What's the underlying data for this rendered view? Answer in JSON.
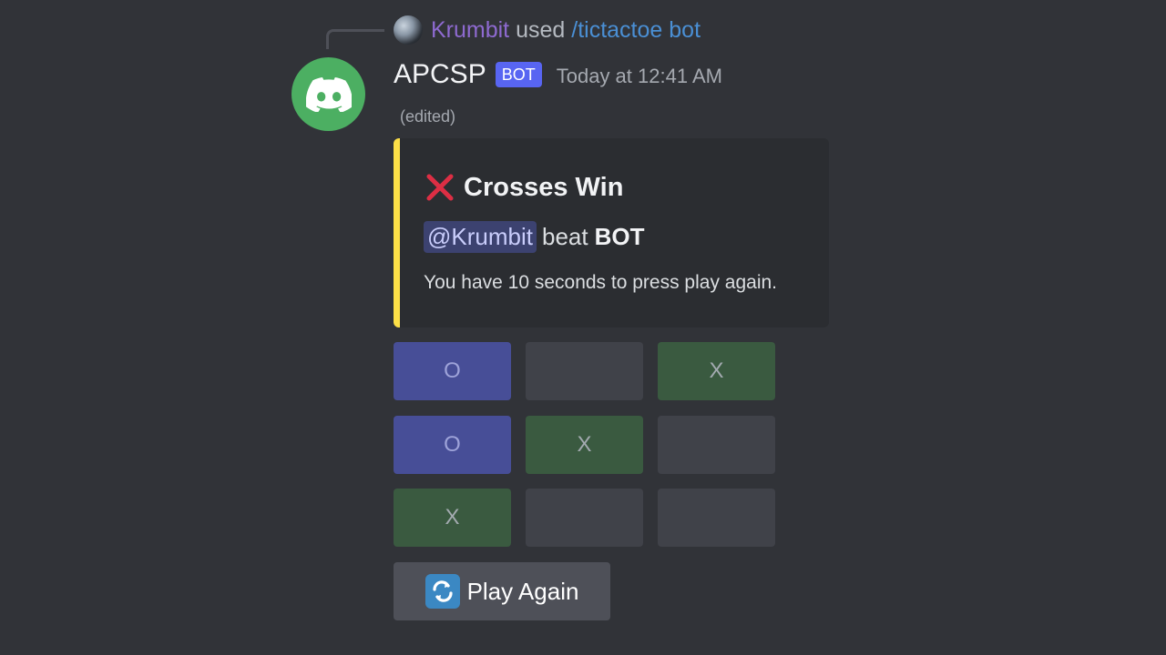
{
  "interaction": {
    "user": "Krumbit",
    "used_text": "used",
    "command": "/tictactoe bot"
  },
  "message": {
    "username": "APCSP",
    "bot_tag": "BOT",
    "timestamp": "Today at 12:41 AM",
    "edited": "(edited)"
  },
  "embed": {
    "accent_color": "#fde047",
    "title": "Crosses Win",
    "title_icon": "red-cross-mark-icon",
    "mention": "@Krumbit",
    "beat_text": "beat",
    "loser": "BOT",
    "description": "You have 10 seconds to press play again."
  },
  "board": {
    "rows": [
      [
        "O",
        "",
        "X"
      ],
      [
        "O",
        "X",
        ""
      ],
      [
        "X",
        "",
        ""
      ]
    ]
  },
  "play_again": {
    "label": "Play Again",
    "icon": "repeat-arrows-icon"
  },
  "colors": {
    "background": "#313338",
    "o_button": "#474e97",
    "x_button": "#3a5a40",
    "empty_button": "#404249",
    "bot_tag": "#5865f2",
    "bot_avatar": "#4caf62"
  }
}
